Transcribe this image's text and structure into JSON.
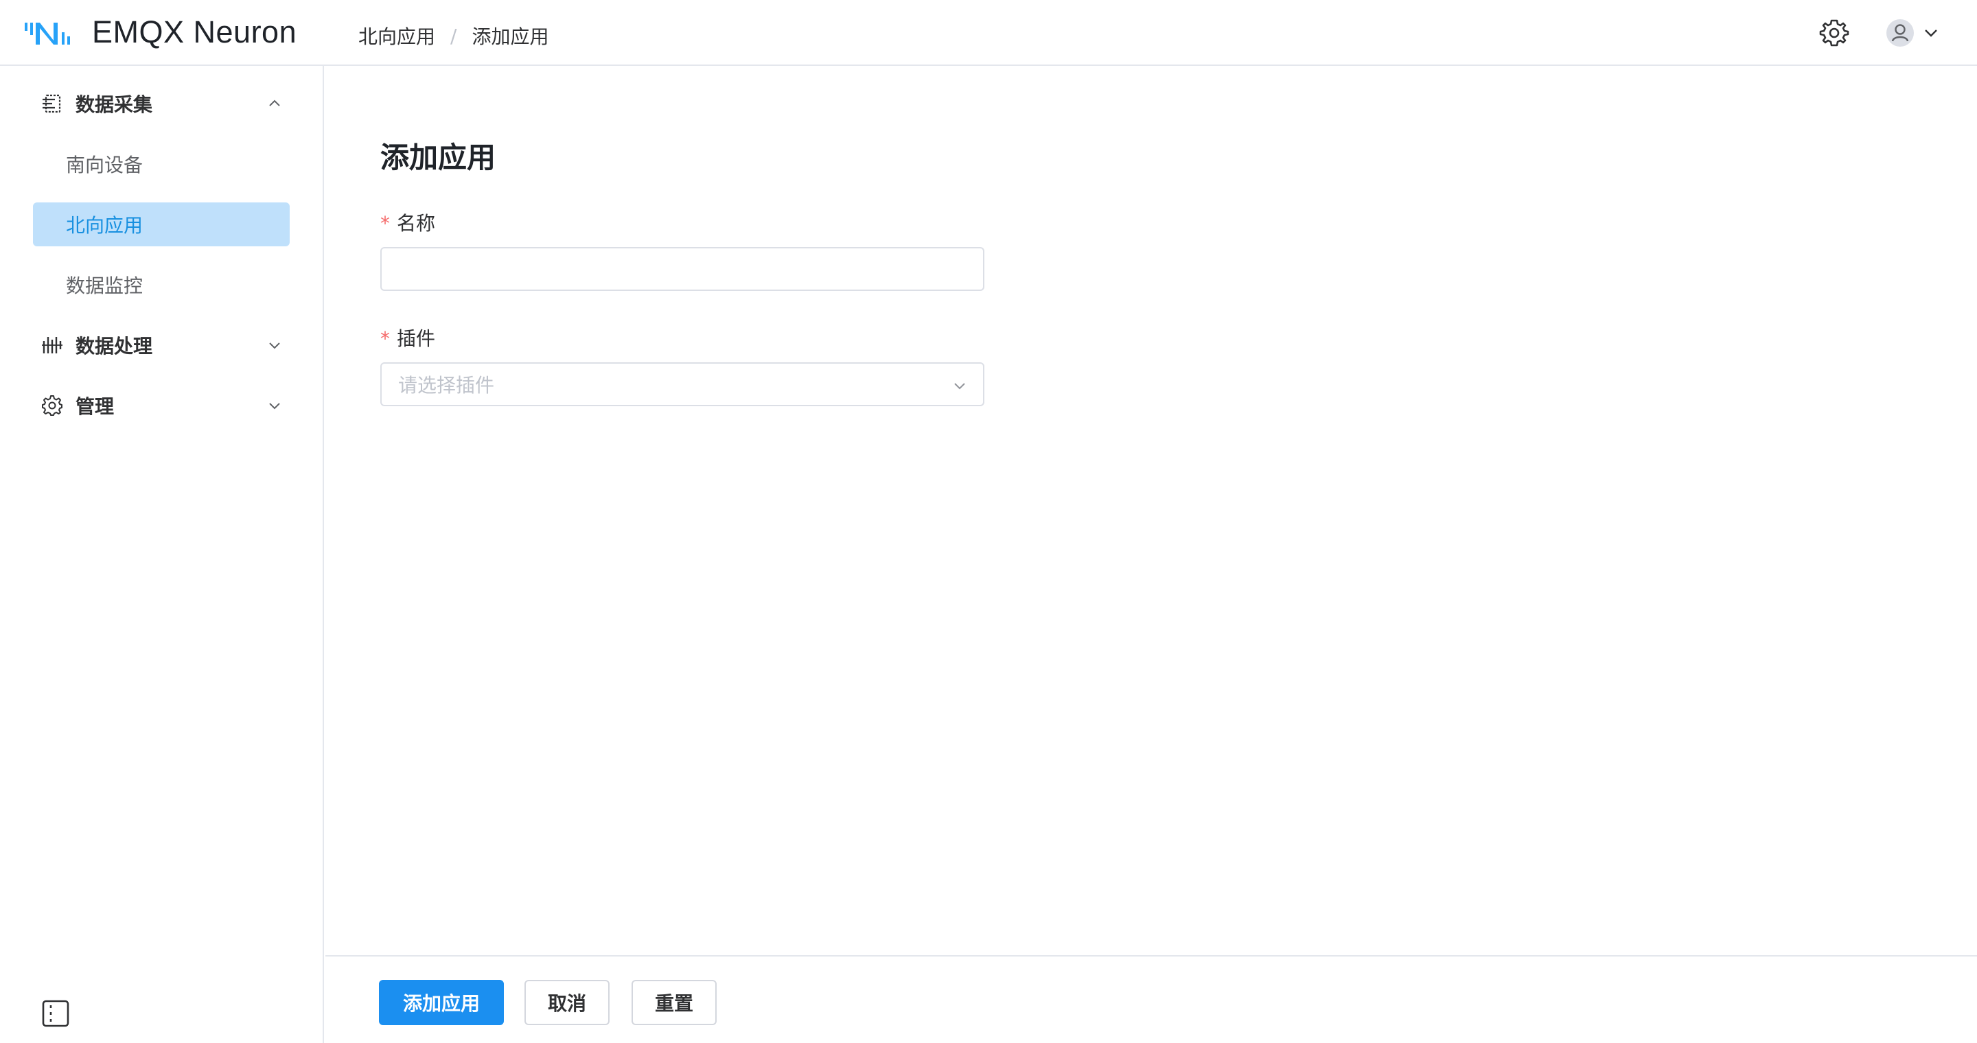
{
  "app": {
    "title": "EMQX Neuron",
    "brand_color": "#27a2f8"
  },
  "breadcrumb": {
    "parent": "北向应用",
    "separator": "/",
    "current": "添加应用"
  },
  "header": {
    "settings_icon": "gear-icon",
    "user_icon": "user-avatar-icon",
    "user_menu_icon": "chevron-down-icon"
  },
  "sidebar": {
    "groups": [
      {
        "label": "数据采集",
        "icon": "data-collection-icon",
        "expanded": true
      },
      {
        "label": "数据处理",
        "icon": "data-processing-icon",
        "expanded": false
      },
      {
        "label": "管理",
        "icon": "gear-icon",
        "expanded": false
      }
    ],
    "items": [
      {
        "label": "南向设备",
        "active": false
      },
      {
        "label": "北向应用",
        "active": true
      },
      {
        "label": "数据监控",
        "active": false
      }
    ],
    "collapse_icon": "sidebar-collapse-icon",
    "active_bg": "#bfe0fb",
    "active_color": "#1890e0"
  },
  "form": {
    "title": "添加应用",
    "name_label": "名称",
    "name_value": "",
    "plugin_label": "插件",
    "plugin_placeholder": "请选择插件",
    "required_mark": "*",
    "required_color": "#f56c6c"
  },
  "footer": {
    "submit_label": "添加应用",
    "cancel_label": "取消",
    "reset_label": "重置",
    "primary_color": "#1b8ff0"
  }
}
